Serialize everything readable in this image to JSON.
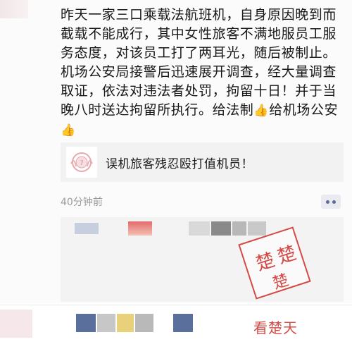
{
  "post": {
    "text": "昨天一家三口乘载法航班机，自身原因晚到而截载不能成行，其中女性旅客不满地服员工服务态度，对该员工打了两耳光，随后被制止。机场公安局接警后迅速展开调查，经大量调查取证，依法对违法者处罚，拘留十日！并于当晚八时送达拘留所执行。给法制",
    "text_mid": "给机场公安",
    "thumb_emoji": "👍"
  },
  "link_card": {
    "title": "误机旅客残忍殴打值机员！"
  },
  "meta": {
    "time_ago": "40分钟前"
  },
  "watermark": {
    "stamp_char_1": "楚",
    "stamp_char_2": "楚",
    "stamp_char_3": "楚",
    "label": "看楚天",
    "color": "#d44a45"
  }
}
